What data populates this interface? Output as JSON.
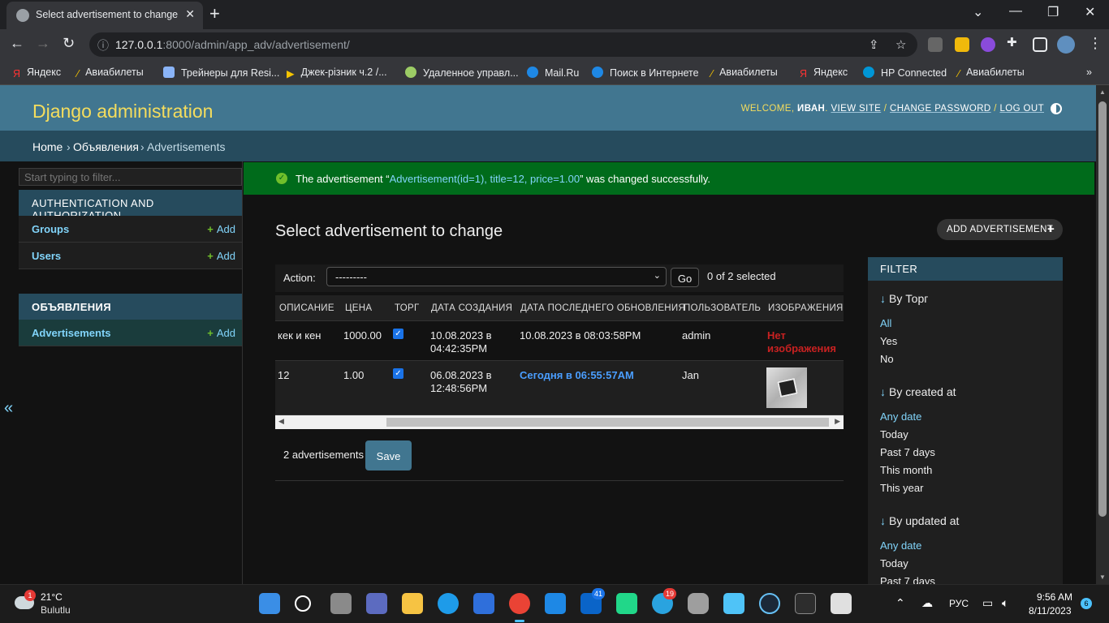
{
  "browser": {
    "tab_title": "Select advertisement to change | Django site admin",
    "url_host": "127.0.0.1",
    "url_rest": ":8000/admin/app_adv/advertisement/",
    "bookmarks": [
      "Яндекс",
      "Авиабилеты",
      "Трейнеры для Resi...",
      "Джек-різник ч.2 /...",
      "Удаленное управл...",
      "Mail.Ru",
      "Поиск в Интернете",
      "Авиабилеты",
      "Яндекс",
      "HP Connected",
      "Авиабилеты"
    ]
  },
  "header": {
    "branding": "Django administration",
    "welcome": "WELCOME, ",
    "username": "ИВАН",
    "view_site": "VIEW SITE",
    "change_password": "CHANGE PASSWORD",
    "log_out": "LOG OUT"
  },
  "breadcrumbs": {
    "home": "Home",
    "app": "Объявления",
    "current": "Advertisements",
    "sep": "›"
  },
  "sidebar": {
    "filter_placeholder": "Start typing to filter...",
    "modules": [
      {
        "caption": "AUTHENTICATION AND AUTHORIZATION",
        "models": [
          {
            "name": "Groups",
            "add": "Add"
          },
          {
            "name": "Users",
            "add": "Add"
          }
        ]
      },
      {
        "caption": "ОБЪЯВЛЕНИЯ",
        "models": [
          {
            "name": "Advertisements",
            "add": "Add"
          }
        ]
      }
    ],
    "collapse": "«"
  },
  "message": {
    "prefix": "The advertisement “",
    "object": "Advertisement(id=1), title=12, price=1.00",
    "suffix": "” was changed successfully."
  },
  "content": {
    "title": "Select advertisement to change",
    "add_button": "ADD ADVERTISEMENT",
    "action_label": "Action:",
    "action_value": "---------",
    "go": "Go",
    "selected": "0 of 2 selected",
    "columns": [
      "ОПИСАНИЕ",
      "ЦЕНА",
      "ТОРГ",
      "ДАТА СОЗДАНИЯ",
      "ДАТА ПОСЛЕДНЕГО ОБНОВЛЕНИЯ",
      "ПОЛЬЗОВАТЕЛЬ",
      "ИЗОБРАЖЕНИЯ"
    ],
    "rows": [
      {
        "description": "кек и кен",
        "price": "1000.00",
        "torg": true,
        "created_1": "10.08.2023 в",
        "created_2": "04:42:35PM",
        "updated": "10.08.2023 в 08:03:58PM",
        "user": "admin",
        "images_1": "Нет",
        "images_2": "изображения"
      },
      {
        "description": "12",
        "price": "1.00",
        "torg": true,
        "created_1": "06.08.2023 в",
        "created_2": "12:48:56PM",
        "updated": "Сегодня в 06:55:57AM",
        "user": "Jan",
        "images": "thumbnail"
      }
    ],
    "count": "2 advertisements",
    "save": "Save"
  },
  "filter": {
    "title": "FILTER",
    "groups": [
      {
        "heading": "By Торг",
        "options": [
          "All",
          "Yes",
          "No"
        ],
        "selected": 0
      },
      {
        "heading": "By created at",
        "options": [
          "Any date",
          "Today",
          "Past 7 days",
          "This month",
          "This year"
        ],
        "selected": 0
      },
      {
        "heading": "By updated at",
        "options": [
          "Any date",
          "Today",
          "Past 7 days"
        ],
        "selected": 0
      }
    ]
  },
  "taskbar": {
    "weather_badge": "1",
    "temp": "21°C",
    "condition": "Bulutlu",
    "badge_outlook": "41",
    "badge_telegram": "19",
    "lang": "РУС",
    "time": "9:56 AM",
    "date": "8/11/2023",
    "notifications": "6"
  },
  "colors": {
    "header": "#417690",
    "breadcrumbs": "#264b5d",
    "success": "#006b1b",
    "link": "#81d4fa",
    "branding": "#f5dd5d"
  }
}
